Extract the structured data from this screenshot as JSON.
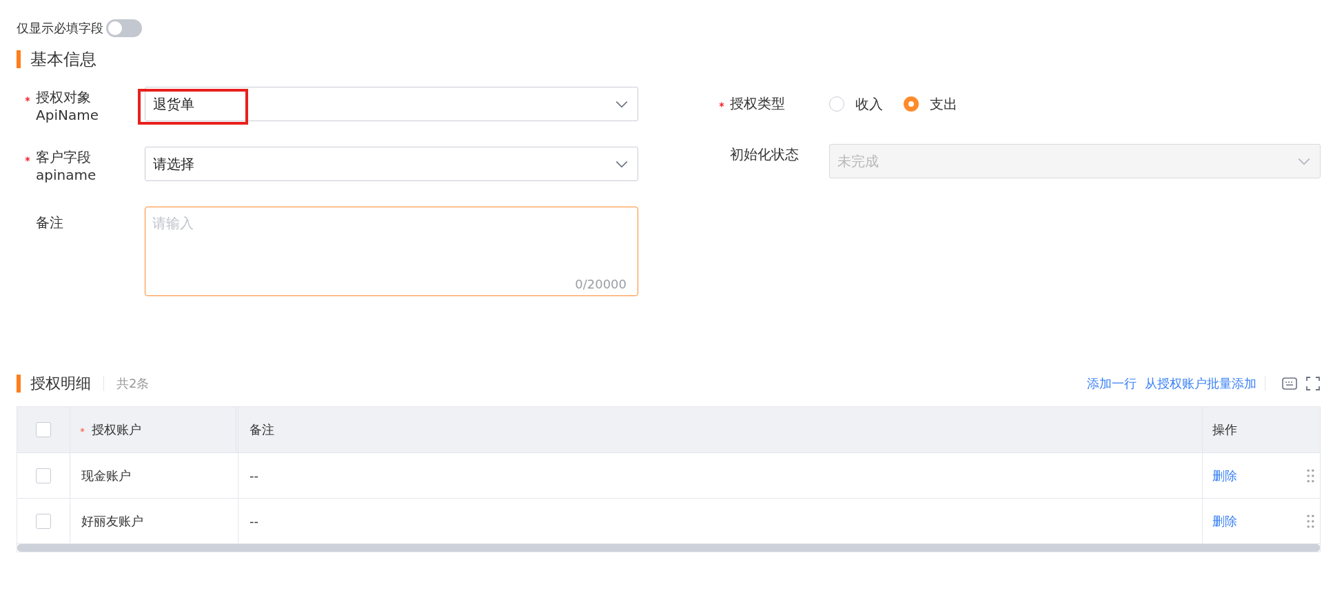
{
  "filter_toggle": {
    "label": "仅显示必填字段",
    "on": false
  },
  "basic_section": {
    "title": "基本信息"
  },
  "form_left": [
    {
      "kind": "select",
      "required": true,
      "label": "授权对象",
      "sublabel": "ApiName",
      "value": "退货单",
      "highlighted": true,
      "disabled": false
    },
    {
      "kind": "select",
      "required": true,
      "label": "客户字段",
      "sublabel": "apiname",
      "value": "请选择",
      "highlighted": false,
      "disabled": false
    },
    {
      "kind": "textarea",
      "required": false,
      "label": "备注",
      "placeholder": "请输入",
      "counter": "0/20000",
      "focused": true
    }
  ],
  "form_right": [
    {
      "kind": "radio",
      "required": true,
      "label": "授权类型",
      "options": [
        {
          "label": "收入",
          "selected": false
        },
        {
          "label": "支出",
          "selected": true
        }
      ]
    },
    {
      "kind": "select",
      "required": false,
      "label": "初始化状态",
      "value": "未完成",
      "disabled": true
    }
  ],
  "detail_section": {
    "title": "授权明细",
    "count": "共2条",
    "actions": [
      "添加一行",
      "从授权账户批量添加"
    ]
  },
  "table": {
    "header_checked": false,
    "columns": [
      {
        "label": "授权账户",
        "required": true
      },
      {
        "label": "备注",
        "required": false
      },
      {
        "label": "操作",
        "required": false
      }
    ],
    "rows": [
      {
        "checked": false,
        "account": "现金账户",
        "remark": "--",
        "action": "删除"
      },
      {
        "checked": false,
        "account": "好丽友账户",
        "remark": "--",
        "action": "删除"
      }
    ]
  }
}
